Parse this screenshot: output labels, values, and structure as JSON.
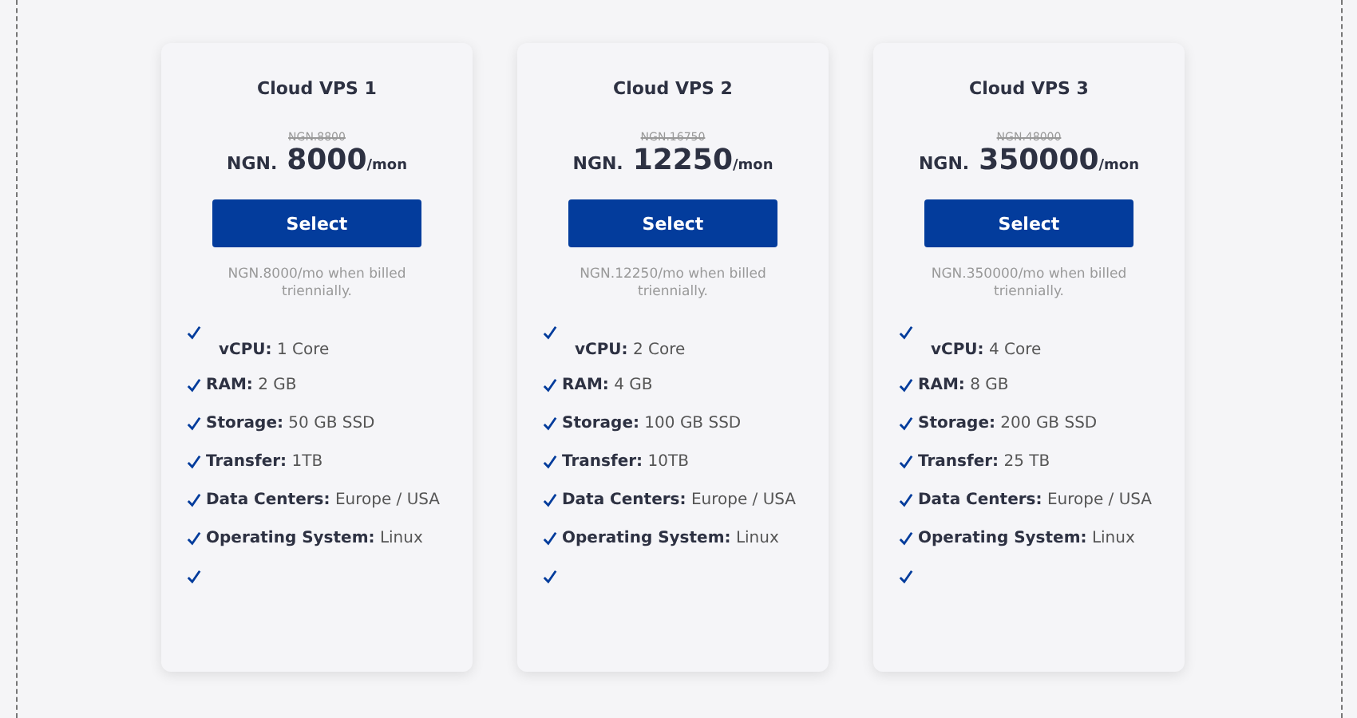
{
  "plans": [
    {
      "title": "Cloud VPS 1",
      "old_price": "NGN.8800",
      "currency": "NGN.",
      "price": "8000",
      "period": "/mon",
      "button": "Select",
      "note": "NGN.8000/mo when billed triennially.",
      "features": [
        {
          "kind": "wrapped",
          "label": "vCPU:",
          "value": "1 Core"
        },
        {
          "kind": "inline",
          "label": "RAM:",
          "value": "2 GB"
        },
        {
          "kind": "inline",
          "label": "Storage:",
          "value": "50 GB SSD"
        },
        {
          "kind": "inline",
          "label": "Transfer:",
          "value": "1TB"
        },
        {
          "kind": "inline",
          "label": "Data Centers:",
          "value": "Europe / USA"
        },
        {
          "kind": "inline",
          "label": "Operating System:",
          "value": "Linux"
        },
        {
          "kind": "blank"
        }
      ]
    },
    {
      "title": "Cloud VPS 2",
      "old_price": "NGN.16750",
      "currency": "NGN.",
      "price": "12250",
      "period": "/mon",
      "button": "Select",
      "note": "NGN.12250/mo when billed triennially.",
      "features": [
        {
          "kind": "wrapped",
          "label": "vCPU:",
          "value": "2 Core"
        },
        {
          "kind": "inline",
          "label": "RAM:",
          "value": "4 GB"
        },
        {
          "kind": "inline",
          "label": "Storage:",
          "value": "100 GB SSD"
        },
        {
          "kind": "inline",
          "label": "Transfer:",
          "value": "10TB"
        },
        {
          "kind": "inline",
          "label": "Data Centers:",
          "value": "Europe / USA"
        },
        {
          "kind": "inline",
          "label": "Operating System:",
          "value": "Linux"
        },
        {
          "kind": "blank"
        }
      ]
    },
    {
      "title": "Cloud VPS 3",
      "old_price": "NGN.48000",
      "currency": "NGN.",
      "price": "350000",
      "period": "/mon",
      "button": "Select",
      "note": "NGN.350000/mo when billed triennially.",
      "features": [
        {
          "kind": "wrapped",
          "label": "vCPU:",
          "value": "4 Core"
        },
        {
          "kind": "inline",
          "label": "RAM:",
          "value": "8 GB"
        },
        {
          "kind": "inline",
          "label": "Storage:",
          "value": "200 GB SSD"
        },
        {
          "kind": "inline",
          "label": "Transfer:",
          "value": "25 TB"
        },
        {
          "kind": "inline",
          "label": "Data Centers:",
          "value": "Europe / USA"
        },
        {
          "kind": "inline",
          "label": "Operating System:",
          "value": "Linux"
        },
        {
          "kind": "blank"
        }
      ]
    }
  ]
}
